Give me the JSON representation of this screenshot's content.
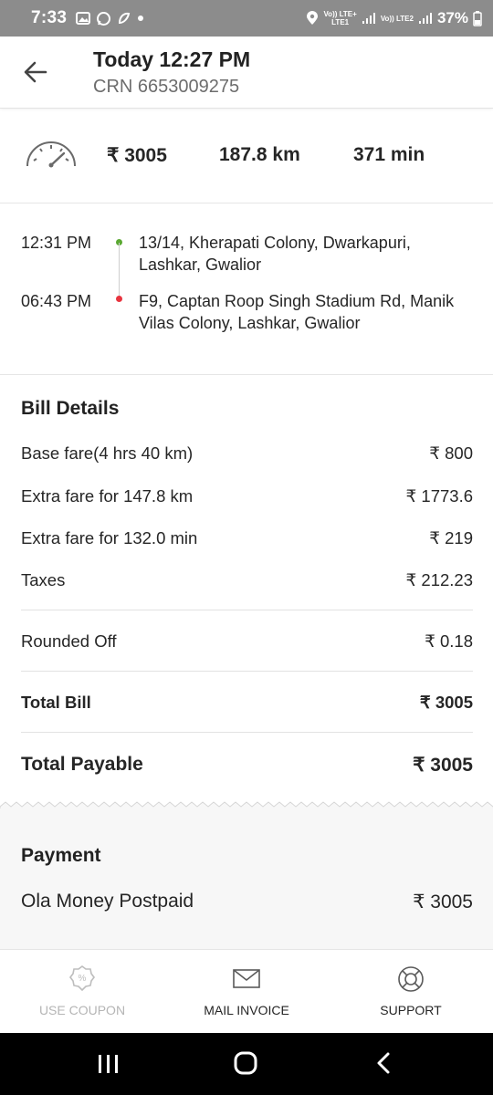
{
  "status_bar": {
    "time": "7:33",
    "net1_top": "Vo)) LTE+",
    "net1_bottom": "LTE1",
    "net2_top": "Vo)) LTE2",
    "battery": "37%"
  },
  "header": {
    "title": "Today 12:27 PM",
    "subtitle": "CRN 6653009275"
  },
  "trip_stats": {
    "fare": "₹ 3005",
    "distance": "187.8 km",
    "duration": "371 min"
  },
  "route": {
    "pickup_time": "12:31 PM",
    "pickup_address": "13/14, Kherapati Colony, Dwarkapuri, Lashkar, Gwalior",
    "drop_time": "06:43 PM",
    "drop_address": "F9, Captan Roop Singh Stadium Rd, Manik Vilas Colony, Lashkar, Gwalior",
    "pickup_color": "#5aa832",
    "drop_color": "#e8343f"
  },
  "bill": {
    "title": "Bill Details",
    "items": [
      {
        "label": "Base fare(4 hrs 40 km)",
        "value": "₹ 800"
      },
      {
        "label": "Extra fare for 147.8 km",
        "value": "₹ 1773.6"
      },
      {
        "label": "Extra fare for 132.0 min",
        "value": "₹ 219"
      },
      {
        "label": "Taxes",
        "value": "₹ 212.23"
      }
    ],
    "rounded_off_label": "Rounded Off",
    "rounded_off_value": "₹ 0.18",
    "total_bill_label": "Total Bill",
    "total_bill_value": "₹ 3005",
    "total_payable_label": "Total Payable",
    "total_payable_value": "₹ 3005"
  },
  "payment": {
    "title": "Payment",
    "method": "Ola Money Postpaid",
    "amount": "₹ 3005"
  },
  "actions": {
    "coupon": "USE COUPON",
    "coupon_color": "#b5b5b5",
    "invoice": "MAIL INVOICE",
    "support": "SUPPORT"
  }
}
